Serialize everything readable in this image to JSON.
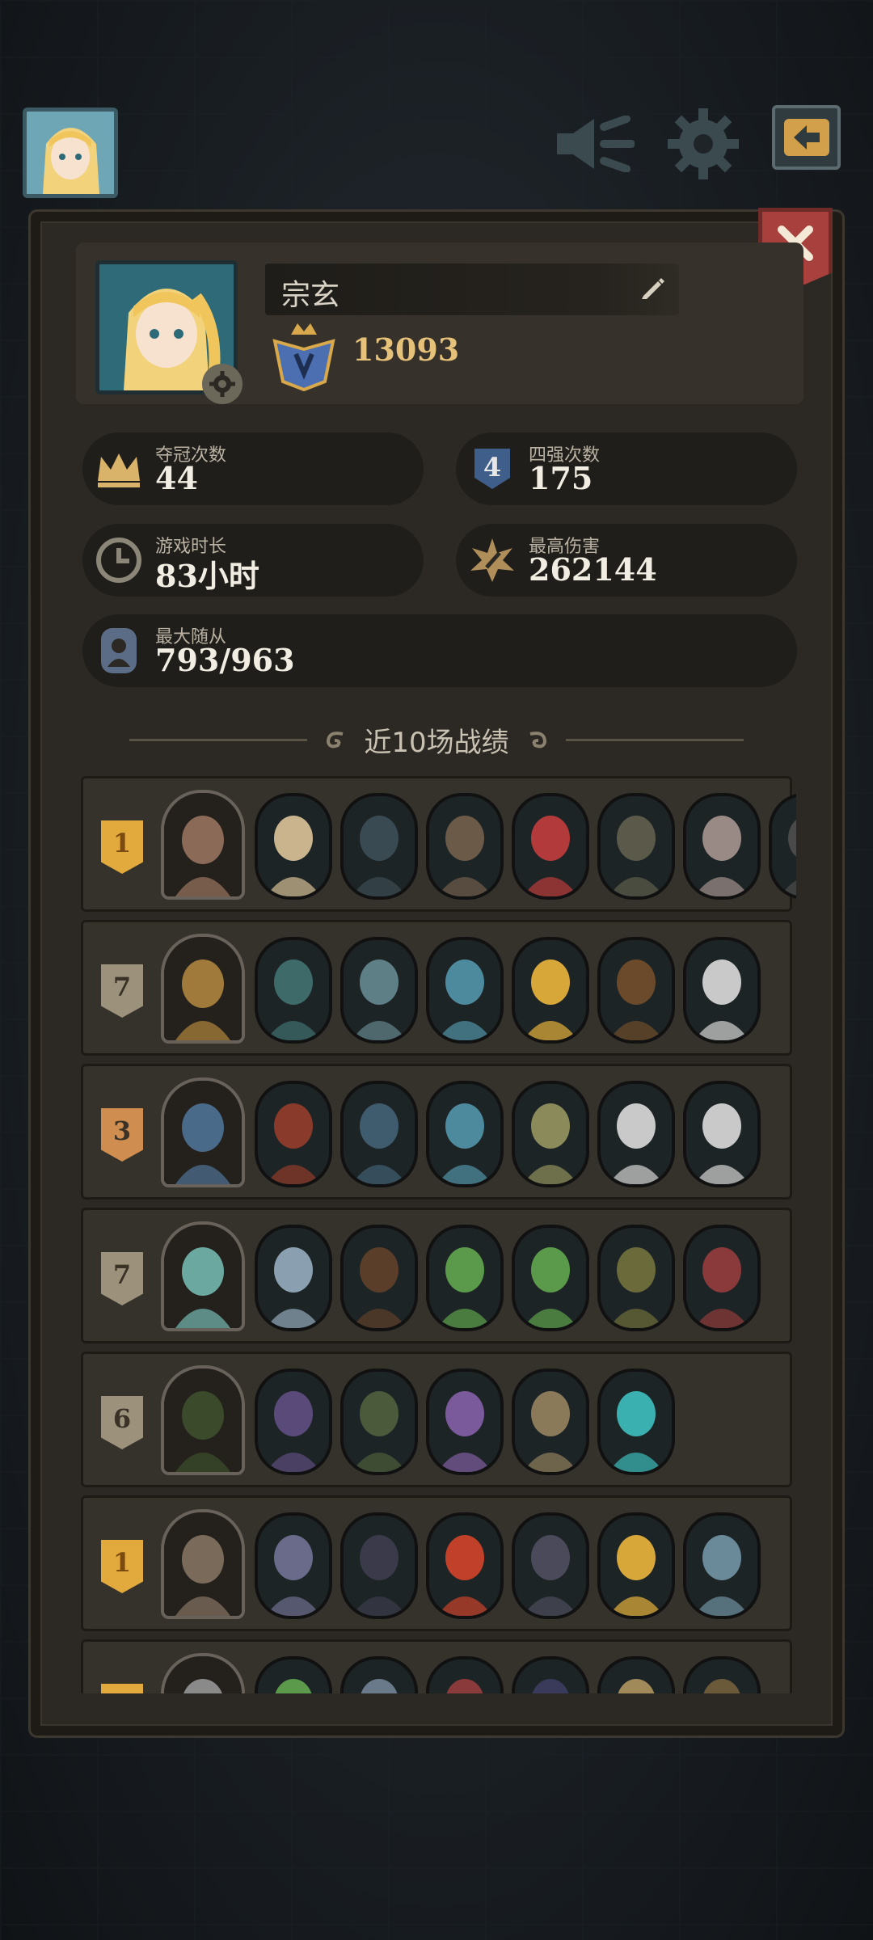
{
  "profile": {
    "name": "宗玄",
    "rank_score": "13093"
  },
  "stats": [
    {
      "label": "夺冠次数",
      "value": "44",
      "icon": "crown-icon"
    },
    {
      "label": "四强次数",
      "value": "175",
      "icon": "top4-shield-icon"
    },
    {
      "label": "游戏时长",
      "value": "83小时",
      "icon": "clock-icon"
    },
    {
      "label": "最高伤害",
      "value": "262144",
      "icon": "damage-burst-icon"
    },
    {
      "label": "最大随从",
      "value": "793/963",
      "icon": "minion-portrait-icon"
    }
  ],
  "recent_section_title": "近10场战绩",
  "matches": [
    {
      "place": "1",
      "badge_color": "#e2a93c",
      "hero_color": "#8c6a58",
      "minions": [
        "#c9b48e",
        "#3a4a52",
        "#6b5a48",
        "#b23a3a",
        "#5b5a4a",
        "#9a8a86",
        "#4a4a4a"
      ]
    },
    {
      "place": "7",
      "badge_color": "#9c927c",
      "hero_color": "#a07a3a",
      "minions": [
        "#3e6a6a",
        "#5f7f87",
        "#4e8a9e",
        "#d8a73a",
        "#6a4a2a",
        "#c9c9c9"
      ]
    },
    {
      "place": "3",
      "badge_color": "#d08d50",
      "hero_color": "#4a6a8a",
      "minions": [
        "#8a3a2a",
        "#3f5c6e",
        "#4e8a9e",
        "#8a8a5a",
        "#c9c9c9",
        "#c9c9c9"
      ]
    },
    {
      "place": "7",
      "badge_color": "#9c927c",
      "hero_color": "#6aa8a0",
      "minions": [
        "#8aa0b0",
        "#5a3e2a",
        "#5a9a4a",
        "#5a9a4a",
        "#6a6a3a",
        "#8a3a3a"
      ]
    },
    {
      "place": "6",
      "badge_color": "#9c927c",
      "hero_color": "#3a4a2a",
      "minions": [
        "#5a4a7a",
        "#4a5a3a",
        "#7a5a9a",
        "#8a7a5a",
        "#3ab0b0"
      ]
    },
    {
      "place": "1",
      "badge_color": "#e2a93c",
      "hero_color": "#7a6a5a",
      "minions": [
        "#6a6a8a",
        "#3a3a4a",
        "#c0402a",
        "#4a4a5a",
        "#d8a73a",
        "#6a8a9a"
      ]
    },
    {
      "place": "",
      "badge_color": "#e2a93c",
      "hero_color": "#8a8a8a",
      "minions": [
        "#5a9a4a",
        "#6a7a8a",
        "#8a3a3a",
        "#3a3a5a",
        "#a08a5a",
        "#6a5a3a"
      ]
    }
  ]
}
